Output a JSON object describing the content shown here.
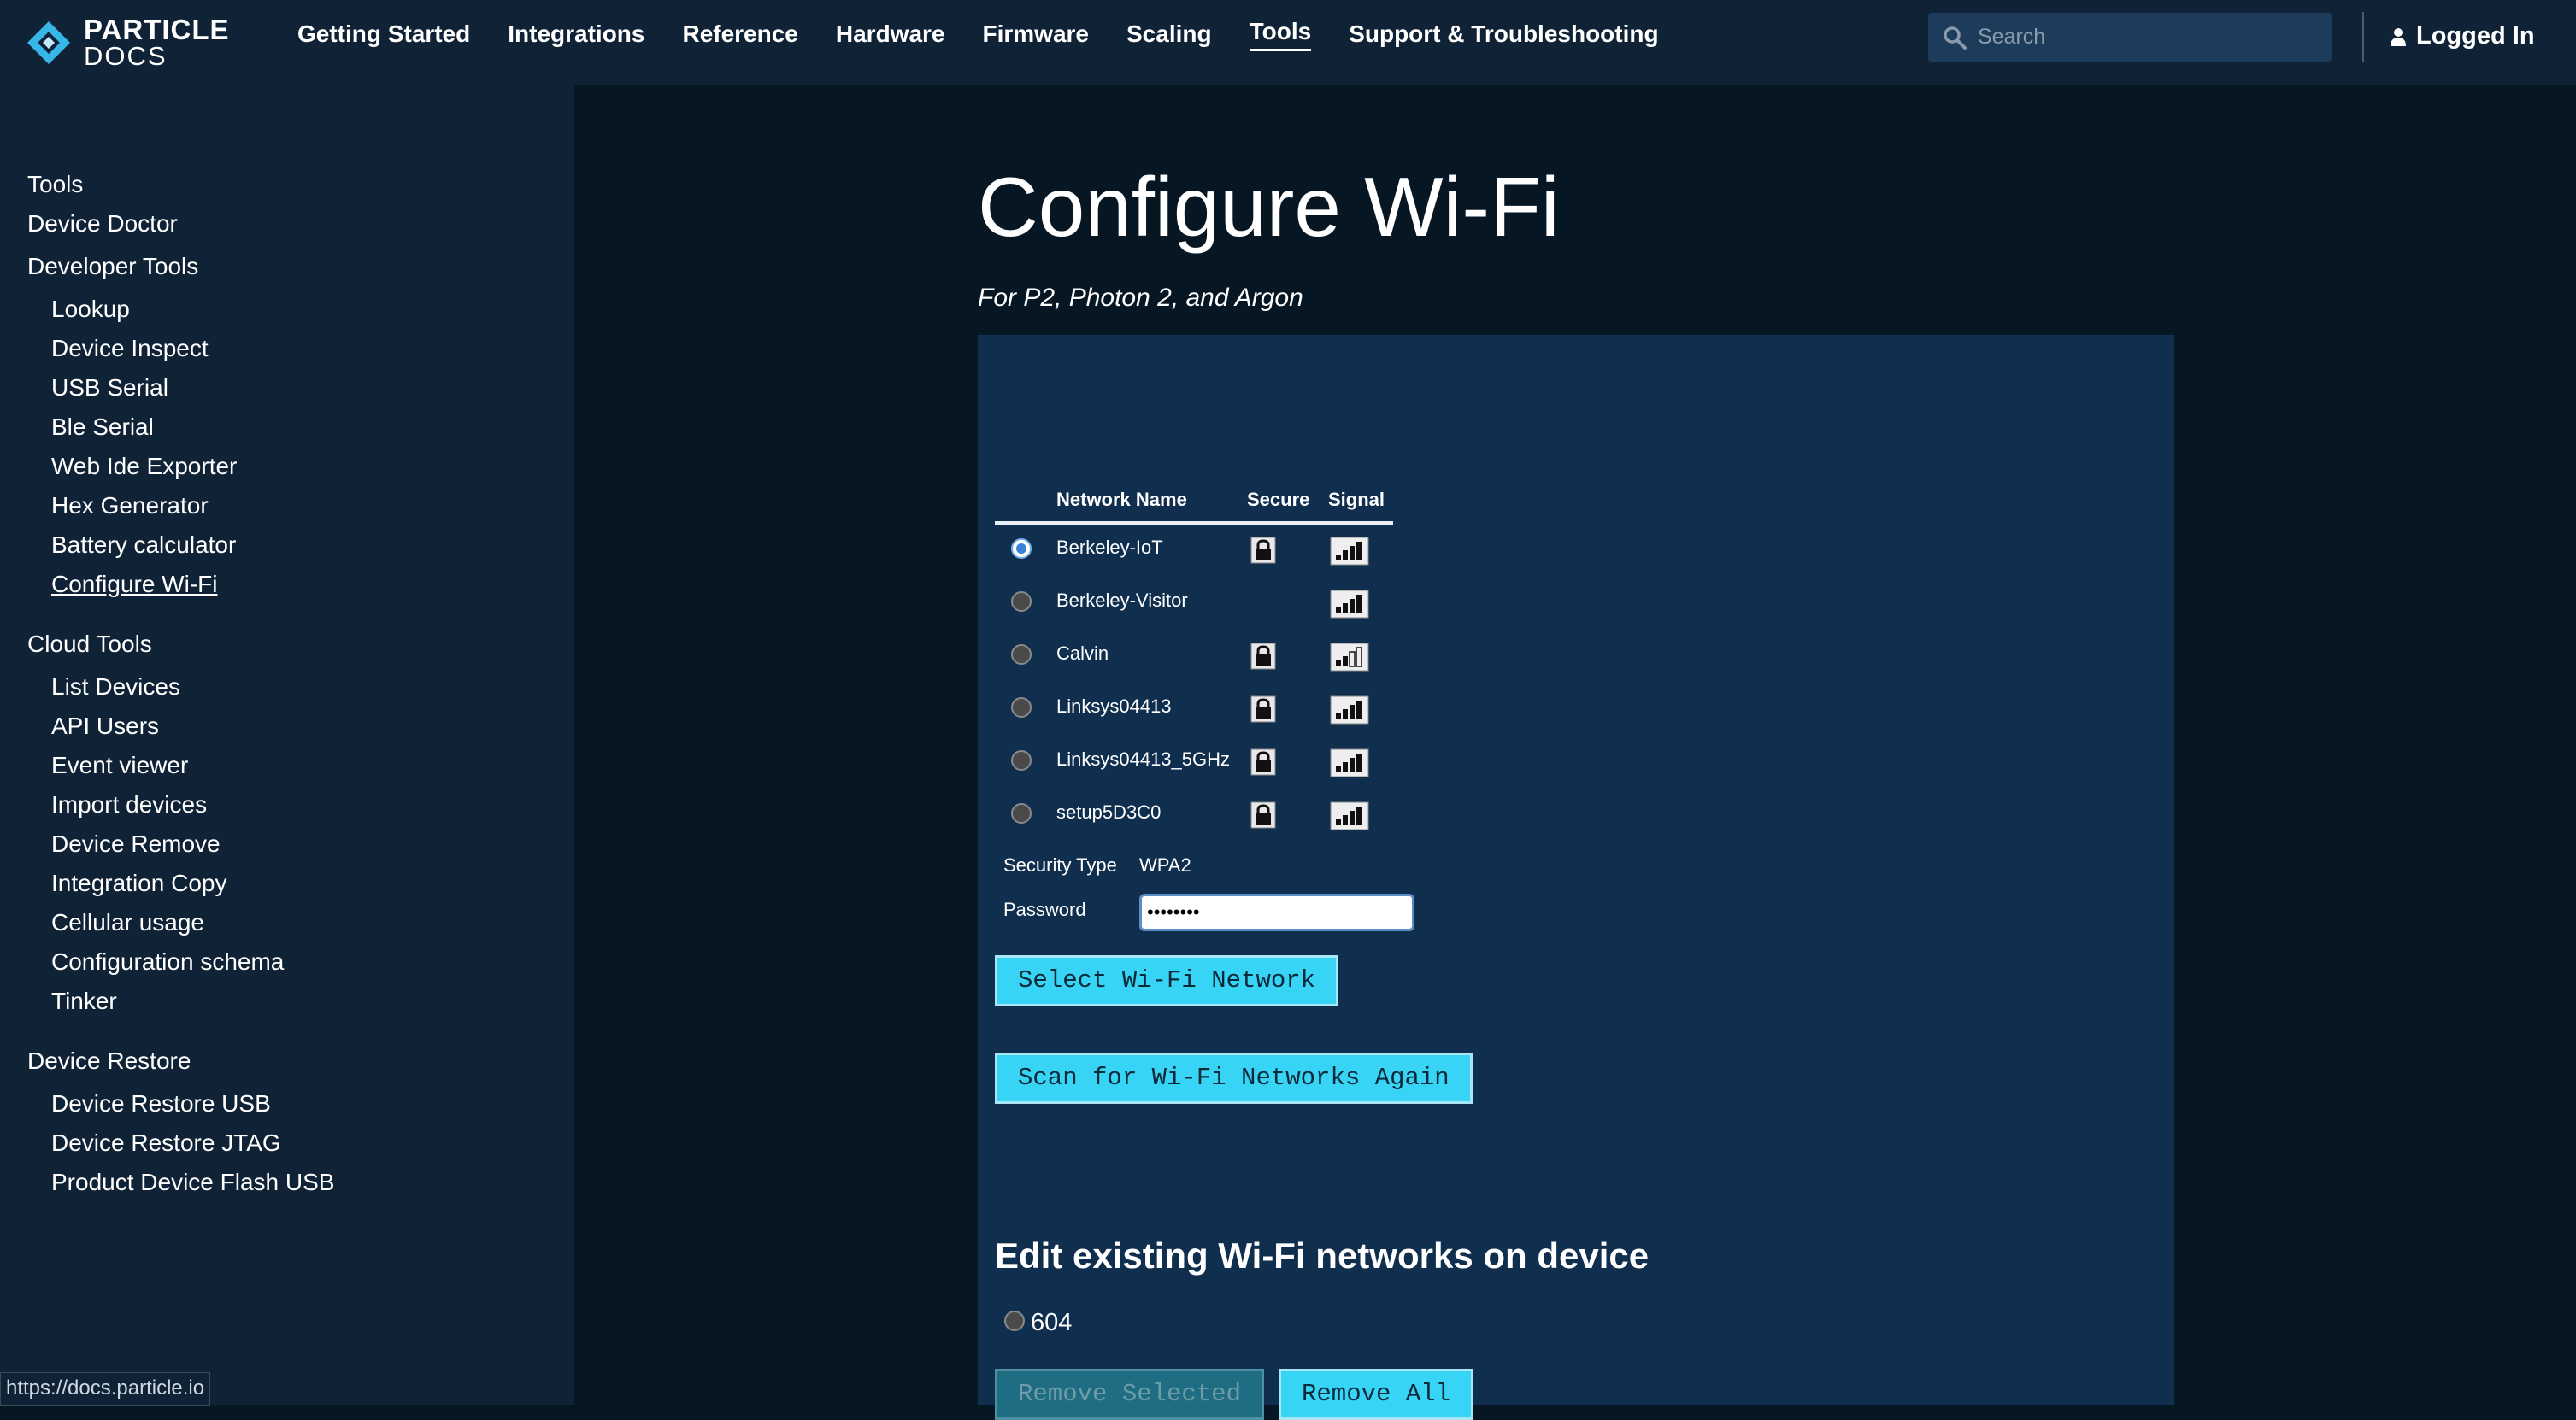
{
  "brand": {
    "line1": "PARTICLE",
    "line2": "DOCS"
  },
  "nav": [
    {
      "label": "Getting Started",
      "active": false
    },
    {
      "label": "Integrations",
      "active": false
    },
    {
      "label": "Reference",
      "active": false
    },
    {
      "label": "Hardware",
      "active": false
    },
    {
      "label": "Firmware",
      "active": false
    },
    {
      "label": "Scaling",
      "active": false
    },
    {
      "label": "Tools",
      "active": true
    },
    {
      "label": "Support & Troubleshooting",
      "active": false
    }
  ],
  "search": {
    "placeholder": "Search",
    "icon": "search-icon"
  },
  "user": {
    "label": "Logged In",
    "icon": "user-icon"
  },
  "sidebar": {
    "tools": "Tools",
    "device_doctor": "Device Doctor",
    "developer_tools": "Developer Tools",
    "dev_items": [
      "Lookup",
      "Device Inspect",
      "USB Serial",
      "Ble Serial",
      "Web Ide Exporter",
      "Hex Generator",
      "Battery calculator",
      "Configure Wi-Fi"
    ],
    "cloud_tools": "Cloud Tools",
    "cloud_items": [
      "List Devices",
      "API Users",
      "Event viewer",
      "Import devices",
      "Device Remove",
      "Integration Copy",
      "Cellular usage",
      "Configuration schema",
      "Tinker"
    ],
    "device_restore": "Device Restore",
    "restore_items": [
      "Device Restore USB",
      "Device Restore JTAG",
      "Product Device Flash USB"
    ],
    "current": "Configure Wi-Fi"
  },
  "page": {
    "title": "Configure Wi-Fi",
    "subtitle": "For P2, Photon 2, and Argon"
  },
  "networks_table": {
    "headers": {
      "name": "Network Name",
      "secure": "Secure",
      "signal": "Signal"
    },
    "rows": [
      {
        "name": "Berkeley-IoT",
        "secure": true,
        "signal_bars": 4,
        "selected": true
      },
      {
        "name": "Berkeley-Visitor",
        "secure": false,
        "signal_bars": 4,
        "selected": false
      },
      {
        "name": "Calvin",
        "secure": true,
        "signal_bars": 2,
        "selected": false
      },
      {
        "name": "Linksys04413",
        "secure": true,
        "signal_bars": 4,
        "selected": false
      },
      {
        "name": "Linksys04413_5GHz",
        "secure": true,
        "signal_bars": 4,
        "selected": false
      },
      {
        "name": "setup5D3C0",
        "secure": true,
        "signal_bars": 4,
        "selected": false
      }
    ]
  },
  "form": {
    "security_label": "Security Type",
    "security_value": "WPA2",
    "password_label": "Password",
    "password_value": "••••••••"
  },
  "buttons": {
    "select": "Select Wi-Fi Network",
    "scan": "Scan for Wi-Fi Networks Again",
    "remove_selected": "Remove Selected",
    "remove_all": "Remove All"
  },
  "existing": {
    "heading": "Edit existing Wi-Fi networks on device",
    "items": [
      "604"
    ]
  },
  "status_url": "https://docs.particle.io",
  "colors": {
    "bg": "#061622",
    "topbar": "#0f2236",
    "panel": "#102e4e",
    "accent": "#38d4f5"
  }
}
